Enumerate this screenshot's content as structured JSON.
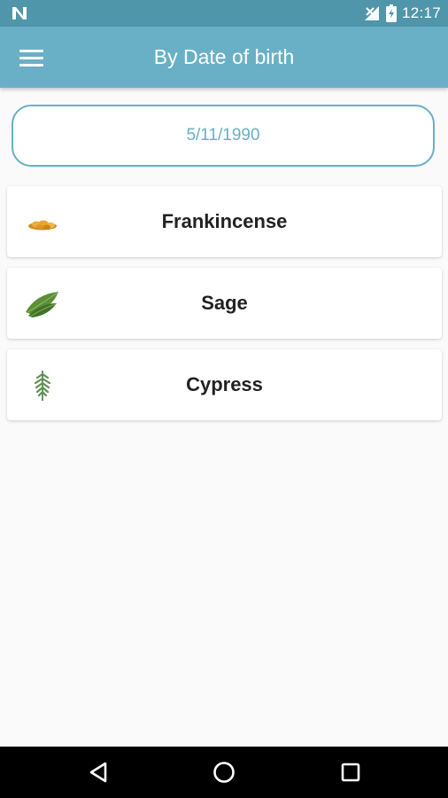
{
  "status_bar": {
    "time": "12:17",
    "icons": [
      "n-logo-icon",
      "no-signal-icon",
      "battery-icon"
    ]
  },
  "app_bar": {
    "title": "By Date of birth",
    "menu_icon": "hamburger-menu-icon"
  },
  "date_field": {
    "value": "5/11/1990"
  },
  "herbs": [
    {
      "name": "Frankincense",
      "icon": "frankincense-image"
    },
    {
      "name": "Sage",
      "icon": "sage-leaf-image"
    },
    {
      "name": "Cypress",
      "icon": "cypress-sprig-image"
    }
  ],
  "nav_bar": {
    "buttons": [
      "back-icon",
      "home-icon",
      "recents-icon"
    ]
  },
  "colors": {
    "status_bar": "#4f96ab",
    "app_bar": "#69b0c7",
    "accent": "#69b0c7",
    "background": "#fafafa"
  }
}
